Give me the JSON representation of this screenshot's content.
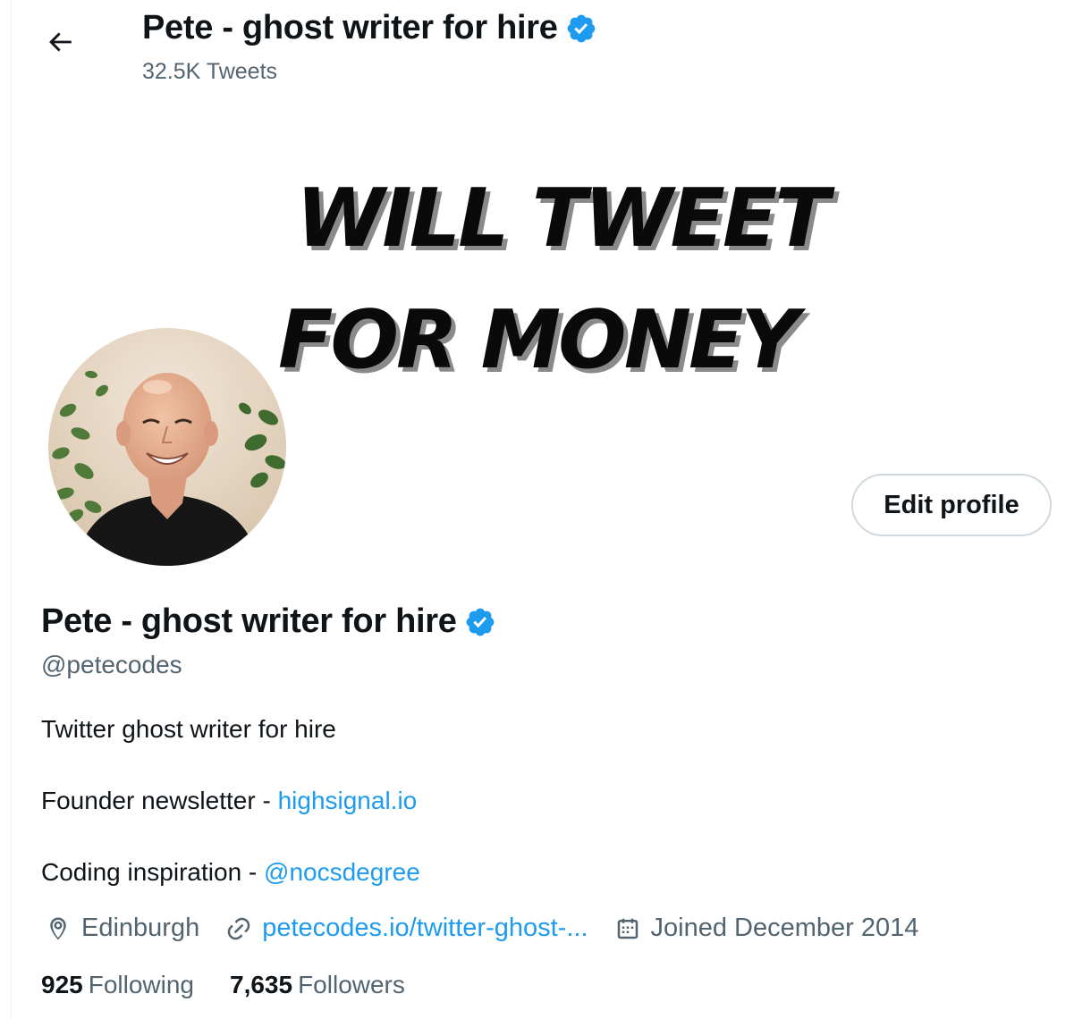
{
  "header": {
    "name": "Pete - ghost writer for hire",
    "tweets_count": "32.5K Tweets"
  },
  "banner": {
    "line1": "WILL TWEET",
    "line2": "FOR MONEY"
  },
  "profile": {
    "edit_label": "Edit profile",
    "name": "Pete - ghost writer for hire",
    "handle": "@petecodes",
    "bio": {
      "line1": "Twitter ghost writer for hire",
      "line2_prefix": "Founder newsletter - ",
      "line2_link": "highsignal.io",
      "line3_prefix": "Coding inspiration - ",
      "line3_link": "@nocsdegree"
    },
    "location": "Edinburgh",
    "website": "petecodes.io/twitter-ghost-...",
    "joined": "Joined December 2014",
    "following_count": "925",
    "following_label": "Following",
    "followers_count": "7,635",
    "followers_label": "Followers"
  },
  "colors": {
    "accent": "#1d9bf0",
    "text": "#0f1419",
    "secondary": "#536471",
    "border": "#cfd9de"
  },
  "icons": {
    "back": "arrow-left-icon",
    "verified": "verified-badge-icon",
    "location": "location-pin-icon",
    "link": "link-icon",
    "calendar": "calendar-icon"
  }
}
